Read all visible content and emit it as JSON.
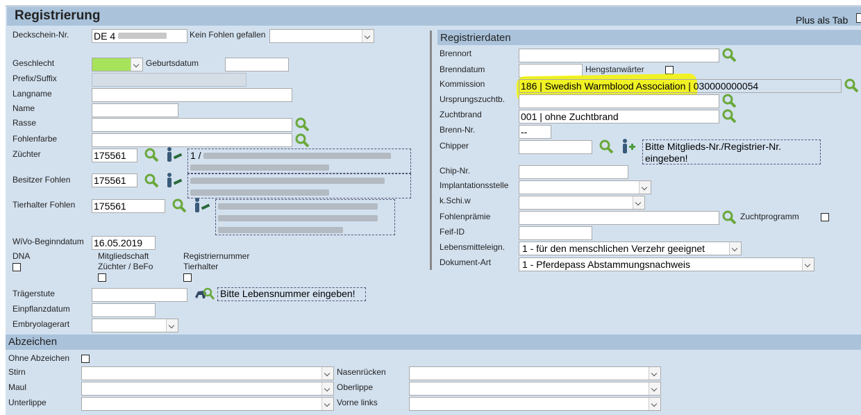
{
  "window": {
    "title": "Registrierung",
    "plus_tab_label": "Plus als Tab"
  },
  "left": {
    "deckschein_label": "Deckschein-Nr.",
    "deckschein_value": "DE 4",
    "kein_fohlen_label": "Kein Fohlen gefallen",
    "geschlecht_label": "Geschlecht",
    "geburtsdatum_label": "Geburtsdatum",
    "prefix_label": "Prefix/Suffix",
    "langname_label": "Langname",
    "name_label": "Name",
    "rasse_label": "Rasse",
    "fohlenfarbe_label": "Fohlenfarbe",
    "zuechter_label": "Züchter",
    "zuechter_value": "175561",
    "zuechter_info_prefix": "1 /",
    "besitzer_label": "Besitzer Fohlen",
    "besitzer_value": "175561",
    "tierhalter_label": "Tierhalter Fohlen",
    "tierhalter_value": "175561",
    "wivo_label": "WiVo-Beginndatum",
    "wivo_value": "16.05.2019",
    "dna_label": "DNA",
    "mitglied_label_1": "Mitgliedschaft",
    "mitglied_label_2": "Züchter / BeFo",
    "regnr_label_1": "Registriernummer",
    "regnr_label_2": "Tierhalter",
    "traegerstute_label": "Trägerstute",
    "lebensnummer_hint": "Bitte Lebensnummer eingeben!",
    "einpflanz_label": "Einpflanzdatum",
    "embryo_label": "Embryolagerart"
  },
  "right": {
    "section_title": "Registrierdaten",
    "brennort_label": "Brennort",
    "brenndatum_label": "Brenndatum",
    "hengst_label": "Hengstanwärter",
    "kommission_label": "Kommission",
    "kommission_value": "186 | Swedish Warmblood Association | 030000000054",
    "ursprung_label": "Ursprungszuchtb.",
    "zuchtbrand_label": "Zuchtbrand",
    "zuchtbrand_value": "001 | ohne Zuchtbrand",
    "brennnr_label": "Brenn-Nr.",
    "brennnr_value": "--",
    "chipper_label": "Chipper",
    "chipper_hint": "Bitte Mitglieds-Nr./Registrier-Nr. eingeben!",
    "chipnr_label": "Chip-Nr.",
    "implant_label": "Implantationsstelle",
    "kschiw_label": "k.Schi.w",
    "praemie_label": "Fohlenprämie",
    "zuchtprogramm_label": "Zuchtprogramm",
    "feif_label": "Feif-ID",
    "lebensmittel_label": "Lebensmitteleign.",
    "lebensmittel_value": "1 - für den menschlichen Verzehr geeignet",
    "dokument_label": "Dokument-Art",
    "dokument_value": "1 - Pferdepass Abstammungsnachweis"
  },
  "abzeichen": {
    "section_title": "Abzeichen",
    "ohne_label": "Ohne Abzeichen",
    "stirn_label": "Stirn",
    "nasen_label": "Nasenrücken",
    "maul_label": "Maul",
    "oberlippe_label": "Oberlippe",
    "unterlippe_label": "Unterlippe",
    "vorne_links_label": "Vorne links"
  },
  "colors": {
    "panel": "#d3e1ef",
    "header": "#aac3db",
    "highlight": "#f5f500",
    "geschlecht_fill": "#a6e35a",
    "search_icon": "#6aa83a"
  }
}
